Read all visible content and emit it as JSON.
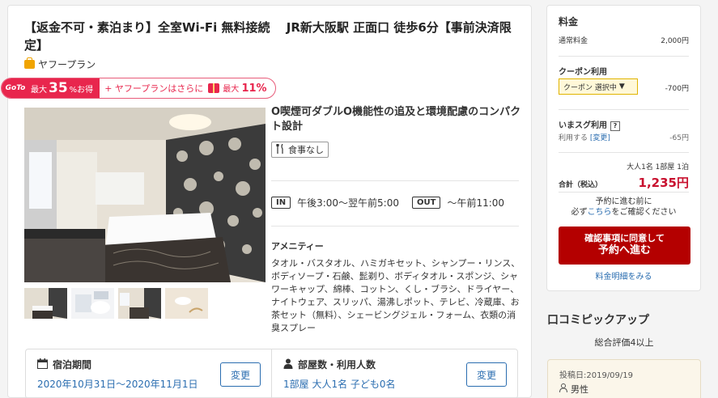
{
  "plan": {
    "title": "【返金不可・素泊まり】全室Wi-Fi 無料接続　 JR新大阪駅 正面口 徒歩6分【事前決済限定】",
    "yahoo_plan_label": "ヤフープラン"
  },
  "goto": {
    "logo": "GoTo",
    "max_label": "最大",
    "max_value": "35",
    "max_suffix": "%お得",
    "plus_label": "+ ヤフープランはさらに",
    "max2_label": "最大",
    "max2_value": "11%"
  },
  "room": {
    "title": "O喫煙可ダブルO機能性の追及と環境配慮のコンパクト設計",
    "meal": "食事なし",
    "checkin_tag": "IN",
    "checkin_time": "午後3:00～翌午前5:00",
    "checkout_tag": "OUT",
    "checkout_time": "～午前11:00",
    "amenity_heading": "アメニティー",
    "amenities": "タオル・バスタオル、ハミガキセット、シャンプー・リンス、ボディソープ・石鹸、髭剃り、ボディタオル・スポンジ、シャワーキャップ、綿棒、コットン、くし・ブラシ、ドライヤー、ナイトウェア、スリッパ、湯沸しポット、テレビ、冷蔵庫、お茶セット（無料）、シェービングジェル・フォーム、衣類の消臭スプレー"
  },
  "stay": {
    "period_label": "宿泊期間",
    "period_value": "2020年10月31日～2020年11月1日",
    "guests_label": "部屋数・利用人数",
    "guests_value": "1部屋 大人1名 子ども0名",
    "change_label": "変更"
  },
  "price": {
    "title": "料金",
    "normal_label": "通常料金",
    "normal_value": "2,000円",
    "coupon_heading": "クーポン利用",
    "coupon_select": "クーポン 選択中",
    "coupon_value": "-700円",
    "ima_heading": "いまスグ利用",
    "ima_help": "?",
    "ima_label": "利用する",
    "ima_change": "[変更]",
    "ima_value": "-65円",
    "guests_summary": "大人1名 1部屋 1泊",
    "total_label": "合計（税込）",
    "total_value": "1,235円",
    "note_line1": "予約に進む前に",
    "note_line2_pre": "必ず",
    "note_line2_link": "こちら",
    "note_line2_post": "をご確認ください",
    "reserve_line1": "確認事項に同意して",
    "reserve_line2": "予約へ進む",
    "detail_link": "料金明細をみる"
  },
  "review": {
    "heading": "口コミピックアップ",
    "rating": "総合評価4以上",
    "date": "投稿日:2019/09/19",
    "gender": "男性"
  }
}
